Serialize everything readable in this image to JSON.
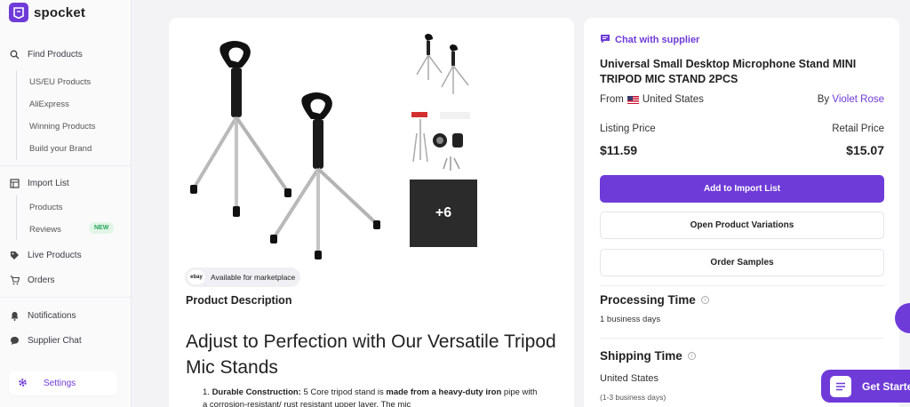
{
  "brand": {
    "name": "spocket"
  },
  "sidebar": {
    "find_products": "Find Products",
    "find_sub": [
      "US/EU Products",
      "AliExpress",
      "Winning Products",
      "Build your Brand"
    ],
    "import_list": "Import List",
    "import_sub": [
      "Products",
      "Reviews"
    ],
    "new_badge": "NEW",
    "live_products": "Live Products",
    "orders": "Orders",
    "notifications": "Notifications",
    "supplier_chat": "Supplier Chat",
    "settings": "Settings"
  },
  "product": {
    "more_images": "+6",
    "marketplace_label": "Available for marketplace",
    "marketplace_logo": "ebay",
    "description_heading": "Product Description",
    "headline": "Adjust to Perfection with Our Versatile Tripod Mic Stands",
    "bullet_1_title": "Durable Construction:",
    "bullet_1_text_a": " 5 Core tripod stand is ",
    "bullet_1_bold": "made from a heavy-duty iron",
    "bullet_1_text_b": " pipe with a corrosion-resistant/ rust resistant upper layer. The mic"
  },
  "panel": {
    "chat_label": "Chat with supplier",
    "title": "Universal Small Desktop Microphone Stand MINI TRIPOD MIC STAND 2PCS",
    "from_label": "From",
    "from_country": "United States",
    "by_label": "By",
    "supplier": "Violet Rose",
    "listing_label": "Listing Price",
    "listing_price": "$11.59",
    "retail_label": "Retail Price",
    "retail_price": "$15.07",
    "add_button": "Add to Import List",
    "variations_button": "Open Product Variations",
    "samples_button": "Order Samples",
    "processing_title": "Processing Time",
    "processing_value": "1 business days",
    "shipping_title": "Shipping Time",
    "shipping_country": "United States",
    "shipping_days": "(1-3 business days)"
  },
  "floating": {
    "get_started": "Get Started"
  },
  "colors": {
    "accent": "#6e3bd8",
    "new_badge": "#26a55a"
  }
}
